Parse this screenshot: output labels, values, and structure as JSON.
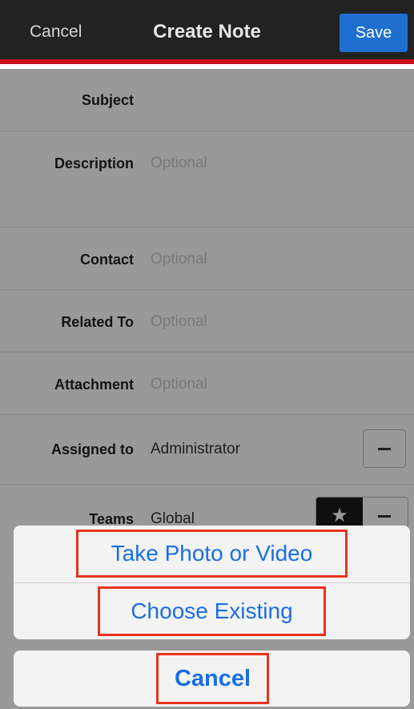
{
  "navbar": {
    "cancel_label": "Cancel",
    "title": "Create Note",
    "save_label": "Save"
  },
  "form": {
    "subject": {
      "label": "Subject",
      "value": ""
    },
    "description": {
      "label": "Description",
      "placeholder": "Optional"
    },
    "contact": {
      "label": "Contact",
      "placeholder": "Optional"
    },
    "related_to": {
      "label": "Related To",
      "placeholder": "Optional"
    },
    "attachment": {
      "label": "Attachment",
      "placeholder": "Optional"
    },
    "assigned_to": {
      "label": "Assigned to",
      "value": "Administrator",
      "remove_icon": "minus-icon"
    },
    "teams": {
      "label": "Teams",
      "value": "Global",
      "primary_icon": "star-icon",
      "remove_icon": "minus-icon"
    }
  },
  "action_sheet": {
    "take_photo_label": "Take Photo or Video",
    "choose_existing_label": "Choose Existing",
    "cancel_label": "Cancel",
    "highlight_color": "#e8341c"
  },
  "colors": {
    "navbar_bg": "#222222",
    "accent_red": "#c8111b",
    "save_blue": "#1f6fd0",
    "sheet_text_blue": "#1a6ee5"
  }
}
